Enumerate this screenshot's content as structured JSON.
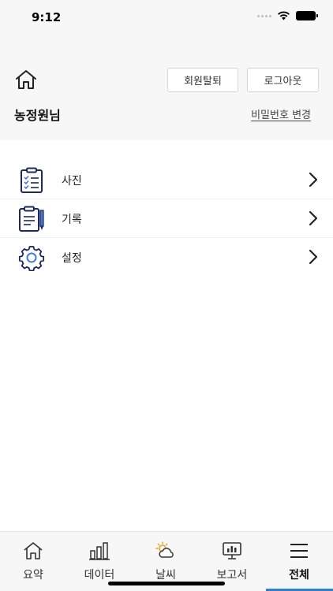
{
  "status": {
    "time": "9:12"
  },
  "header": {
    "withdraw_label": "회원탈퇴",
    "logout_label": "로그아웃",
    "user_name": "농정원님",
    "change_password_label": "비밀번호 변경"
  },
  "menu": {
    "items": [
      {
        "label": "사진",
        "icon": "clipboard-checklist-icon"
      },
      {
        "label": "기록",
        "icon": "clipboard-pencil-icon"
      },
      {
        "label": "설정",
        "icon": "gear-icon"
      }
    ]
  },
  "tabs": [
    {
      "label": "요약",
      "icon": "home-icon"
    },
    {
      "label": "데이터",
      "icon": "bar-chart-icon"
    },
    {
      "label": "날씨",
      "icon": "weather-icon"
    },
    {
      "label": "보고서",
      "icon": "monitor-report-icon"
    },
    {
      "label": "전체",
      "icon": "menu-icon",
      "active": true
    }
  ],
  "colors": {
    "accent": "#2f7fd6",
    "icon_navy": "#1c2a5a",
    "icon_blue": "#4a78d0"
  }
}
